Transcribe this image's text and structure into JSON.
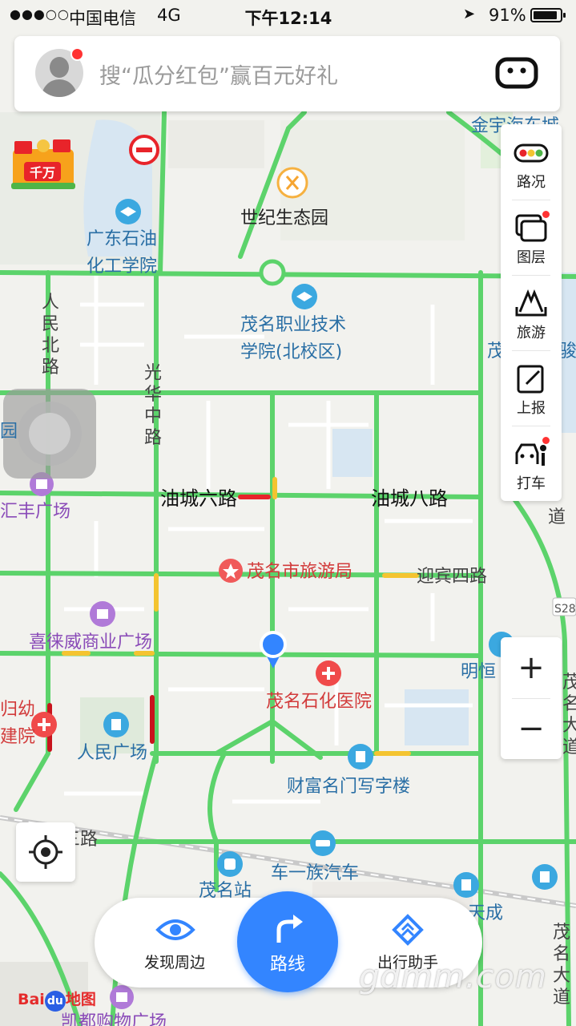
{
  "status_bar": {
    "signal": "●●●○○",
    "carrier": "中国电信",
    "network": "4G",
    "time": "下午12:14",
    "battery": "91%",
    "battery_level": 0.91
  },
  "search": {
    "placeholder": "搜“瓜分红包”赢百元好礼"
  },
  "gift_badge": "千万",
  "side_panel": [
    {
      "label": "路况",
      "icon": "traffic-light-icon"
    },
    {
      "label": "图层",
      "icon": "layers-icon"
    },
    {
      "label": "旅游",
      "icon": "travel-icon"
    },
    {
      "label": "上报",
      "icon": "report-icon"
    },
    {
      "label": "打车",
      "icon": "taxi-icon"
    }
  ],
  "zoom": {
    "in": "+",
    "out": "−"
  },
  "bottom_bar": {
    "discover": "发现周边",
    "route": "路线",
    "assistant": "出行助手"
  },
  "brand": {
    "bai": "Bai",
    "du": "du",
    "ditu": "地图"
  },
  "watermark": "gdmm.com",
  "map_labels": {
    "shiji": "世纪生态园",
    "gdsy1": "广东石油",
    "gdsy2": "化工学院",
    "zmzy1": "茂名职业技术",
    "zmzy2": "学院(北校区)",
    "renmin1": "人",
    "renmin2": "民",
    "renmin3": "北",
    "renmin4": "路",
    "guanghua1": "光",
    "guanghua2": "华",
    "guanghua3": "中",
    "guanghua4": "路",
    "youcheng6": "油城六路",
    "youcheng8": "油城八路",
    "huifeng": "汇丰广场",
    "lvyou": "茂名市旅游局",
    "yingbin": "迎宾四路",
    "xilaiwei": "喜徕威商业广场",
    "shihua": "茂名石化医院",
    "fuyou1": "归幼",
    "fuyou2": "建院",
    "renminsq": "人民广场",
    "caifu": "财富名门写字楼",
    "guangzhi": "官化三路",
    "cheyizu": "车一族汽车",
    "maomingzhan": "茂名站",
    "tiancheng": "天成",
    "mingheng": "明恒",
    "kaidu": "凯都购物广场",
    "jinyu": "金宇海东城",
    "s28": "S28",
    "yuan": "园",
    "dao": "道",
    "mao1": "茂",
    "ming1": "名",
    "da1": "大",
    "dao2": "道",
    "jun1": "骏",
    "mao2": "茂",
    "ming2": "名",
    "da2": "大",
    "dao3": "道"
  }
}
